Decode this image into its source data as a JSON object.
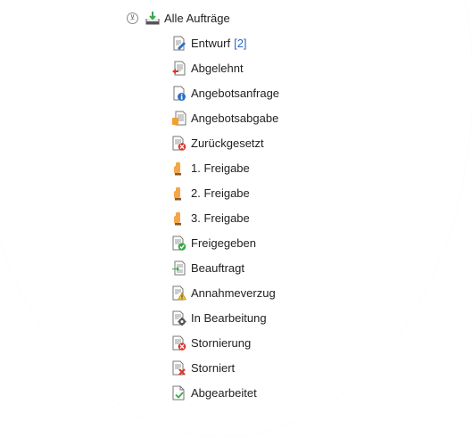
{
  "root": {
    "toggle_glyph": "⊘",
    "label": "Alle Aufträge",
    "icon": "inbox-download-icon"
  },
  "items": [
    {
      "label": "Entwurf",
      "count": "[2]",
      "icon": "document-edit-icon"
    },
    {
      "label": "Abgelehnt",
      "icon": "document-reject-icon"
    },
    {
      "label": "Angebotsanfrage",
      "icon": "document-info-icon"
    },
    {
      "label": "Angebotsabgabe",
      "icon": "document-offer-icon"
    },
    {
      "label": "Zurückgesetzt",
      "icon": "document-reset-icon"
    },
    {
      "label": "1. Freigabe",
      "icon": "hand-icon"
    },
    {
      "label": "2. Freigabe",
      "icon": "hand-icon"
    },
    {
      "label": "3. Freigabe",
      "icon": "hand-icon"
    },
    {
      "label": "Freigegeben",
      "icon": "document-approved-icon"
    },
    {
      "label": "Beauftragt",
      "icon": "document-arrow-icon"
    },
    {
      "label": "Annahmeverzug",
      "icon": "document-warning-icon"
    },
    {
      "label": "In Bearbeitung",
      "icon": "document-gear-icon"
    },
    {
      "label": "Stornierung",
      "icon": "document-cancel-icon"
    },
    {
      "label": "Storniert",
      "icon": "document-x-icon"
    },
    {
      "label": "Abgearbeitet",
      "icon": "document-check-icon"
    }
  ],
  "colors": {
    "count": "#2c63c5",
    "green": "#3aa64a",
    "red": "#d9362b",
    "blue": "#2c6fc7",
    "orange": "#f0a030"
  }
}
